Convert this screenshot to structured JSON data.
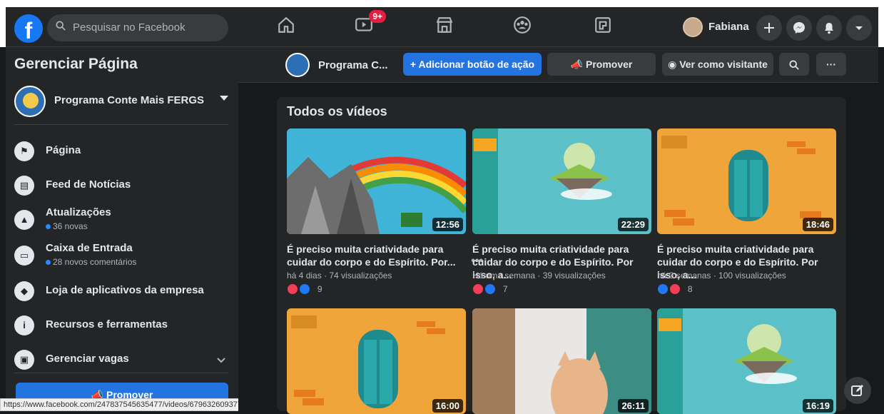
{
  "topbar": {
    "search_placeholder": "Pesquisar no Facebook",
    "nav": [
      {
        "name": "home-icon"
      },
      {
        "name": "watch-icon",
        "badge": "9+"
      },
      {
        "name": "marketplace-icon"
      },
      {
        "name": "groups-icon"
      },
      {
        "name": "gaming-icon"
      }
    ],
    "profile_name": "Fabiana"
  },
  "sidebar": {
    "title": "Gerenciar Página",
    "page_name": "Programa Conte Mais FERGS",
    "items": [
      {
        "label": "Página",
        "icon": "flag-icon"
      },
      {
        "label": "Feed de Notícias",
        "icon": "news-feed-icon"
      },
      {
        "label": "Atualizações",
        "sub": "36 novas",
        "icon": "updates-icon"
      },
      {
        "label": "Caixa de Entrada",
        "sub": "28 novos comentários",
        "icon": "inbox-icon"
      },
      {
        "label": "Loja de aplicativos da empresa",
        "icon": "app-store-icon"
      },
      {
        "label": "Recursos e ferramentas",
        "icon": "info-icon"
      },
      {
        "label": "Gerenciar vagas",
        "icon": "briefcase-icon"
      }
    ],
    "promote_label": "Promover"
  },
  "status_url": "https://www.facebook.com/247837545635477/videos/679632609377365/",
  "actionbar": {
    "page_name": "Programa C...",
    "add_action_label": "+ Adicionar botão de ação",
    "promote_label": "Promover",
    "view_as_label": "Ver como visitante",
    "more_label": "···"
  },
  "videos": {
    "title": "Todos os vídeos",
    "items": [
      {
        "title": "É preciso muita criatividade para cuidar do corpo e do Espírito. Por...",
        "meta": "há 4 dias · 74 visualizações",
        "duration": "12:56",
        "reactions": [
          "love",
          "like"
        ],
        "count": "9"
      },
      {
        "title": "É preciso muita criatividade para cuidar do corpo e do Espírito. Por isso, a...",
        "meta": "Há uma semana · 39 visualizações",
        "duration": "22:29",
        "reactions": [
          "love",
          "like"
        ],
        "count": "7"
      },
      {
        "title": "É preciso muita criatividade para cuidar do corpo e do Espírito. Por isso, a...",
        "meta": "há 3 semanas · 100 visualizações",
        "duration": "18:46",
        "reactions": [
          "like",
          "love"
        ],
        "count": "8"
      },
      {
        "duration": "16:00"
      },
      {
        "duration": "26:11"
      },
      {
        "duration": "16:19"
      }
    ]
  },
  "colors": {
    "accent": "#2374e1",
    "surface": "#242526",
    "background": "#18191a"
  }
}
